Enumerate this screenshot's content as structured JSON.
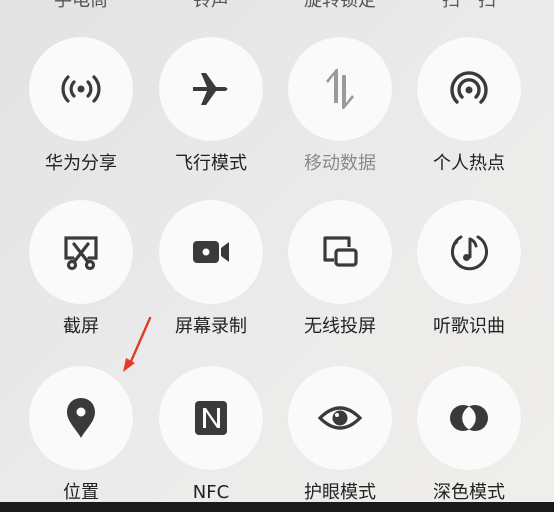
{
  "top_cutoff": [
    "手电筒",
    "铃声",
    "旋转锁定",
    "扫一扫"
  ],
  "tiles": [
    {
      "label": "华为分享",
      "icon": "huawei-share-icon",
      "state": "off"
    },
    {
      "label": "飞行模式",
      "icon": "airplane-icon",
      "state": "off"
    },
    {
      "label": "移动数据",
      "icon": "mobile-data-icon",
      "state": "disabled"
    },
    {
      "label": "个人热点",
      "icon": "hotspot-icon",
      "state": "off"
    },
    {
      "label": "截屏",
      "icon": "screenshot-icon",
      "state": "off"
    },
    {
      "label": "屏幕录制",
      "icon": "screen-record-icon",
      "state": "off"
    },
    {
      "label": "无线投屏",
      "icon": "wireless-projection-icon",
      "state": "off"
    },
    {
      "label": "听歌识曲",
      "icon": "music-recognition-icon",
      "state": "off"
    },
    {
      "label": "位置",
      "icon": "location-icon",
      "state": "off"
    },
    {
      "label": "NFC",
      "icon": "nfc-icon",
      "state": "off"
    },
    {
      "label": "护眼模式",
      "icon": "eye-comfort-icon",
      "state": "off"
    },
    {
      "label": "深色模式",
      "icon": "dark-mode-icon",
      "state": "off"
    }
  ],
  "colors": {
    "icon": "#3a3a3a",
    "icon_disabled": "#9a9a9a",
    "tile_bg": "#fafafa",
    "annotation_arrow": "#e53a2b"
  }
}
